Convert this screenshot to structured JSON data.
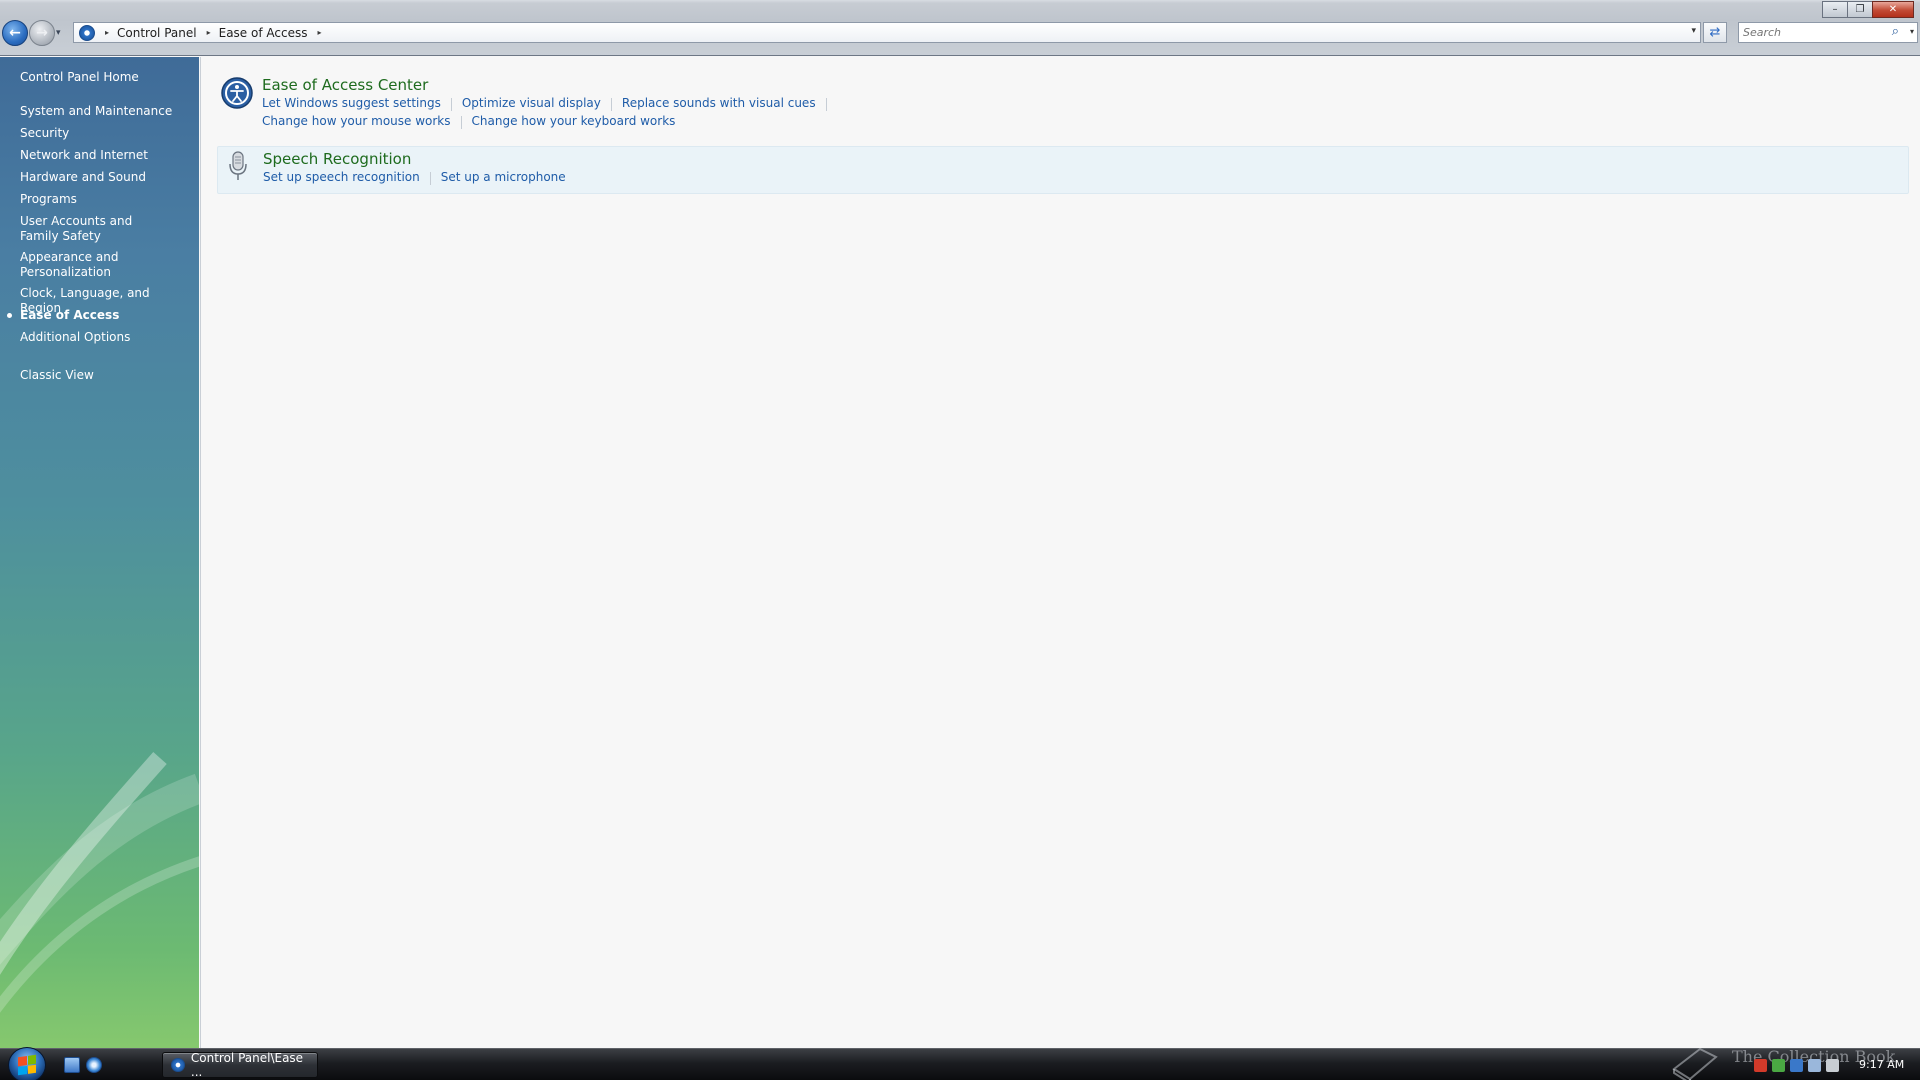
{
  "window": {
    "minimize_glyph": "–",
    "maximize_glyph": "❐",
    "close_glyph": "✕"
  },
  "nav": {
    "back_glyph": "←",
    "forward_glyph": "→",
    "dropdown_glyph": "▾"
  },
  "address": {
    "separator": "▸",
    "breadcrumbs": [
      "Control Panel",
      "Ease of Access"
    ],
    "dropdown_glyph": "▾",
    "refresh_glyph": "⇄"
  },
  "search": {
    "placeholder": "Search",
    "icon_glyph": "⌕",
    "dropdown_glyph": "▾"
  },
  "sidebar": {
    "items": [
      {
        "label": "Control Panel Home"
      },
      {
        "label": "System and Maintenance"
      },
      {
        "label": "Security"
      },
      {
        "label": "Network and Internet"
      },
      {
        "label": "Hardware and Sound"
      },
      {
        "label": "Programs"
      },
      {
        "label": "User Accounts and Family Safety"
      },
      {
        "label": "Appearance and Personalization"
      },
      {
        "label": "Clock, Language, and Region"
      },
      {
        "label": "Ease of Access",
        "active": true
      },
      {
        "label": "Additional Options"
      },
      {
        "label": "Classic View"
      }
    ]
  },
  "main": {
    "tasks": [
      {
        "title": "Ease of Access Center",
        "icon": "ease-of-access-icon",
        "links_row1": [
          "Let Windows suggest settings",
          "Optimize visual display",
          "Replace sounds with visual cues"
        ],
        "links_row2": [
          "Change how your mouse works",
          "Change how your keyboard works"
        ]
      },
      {
        "title": "Speech Recognition",
        "icon": "microphone-icon",
        "links_row1": [
          "Set up speech recognition",
          "Set up a microphone"
        ]
      }
    ]
  },
  "taskbar": {
    "window_button_label": "Control Panel\\Ease ...",
    "watermark": "The Collection Book",
    "clock": "9:17 AM"
  },
  "colors": {
    "link": "#1f5ca8",
    "task_title": "#1e6b1e",
    "sidebar_top": "#3f6b98",
    "sidebar_bottom": "#86c86e"
  }
}
